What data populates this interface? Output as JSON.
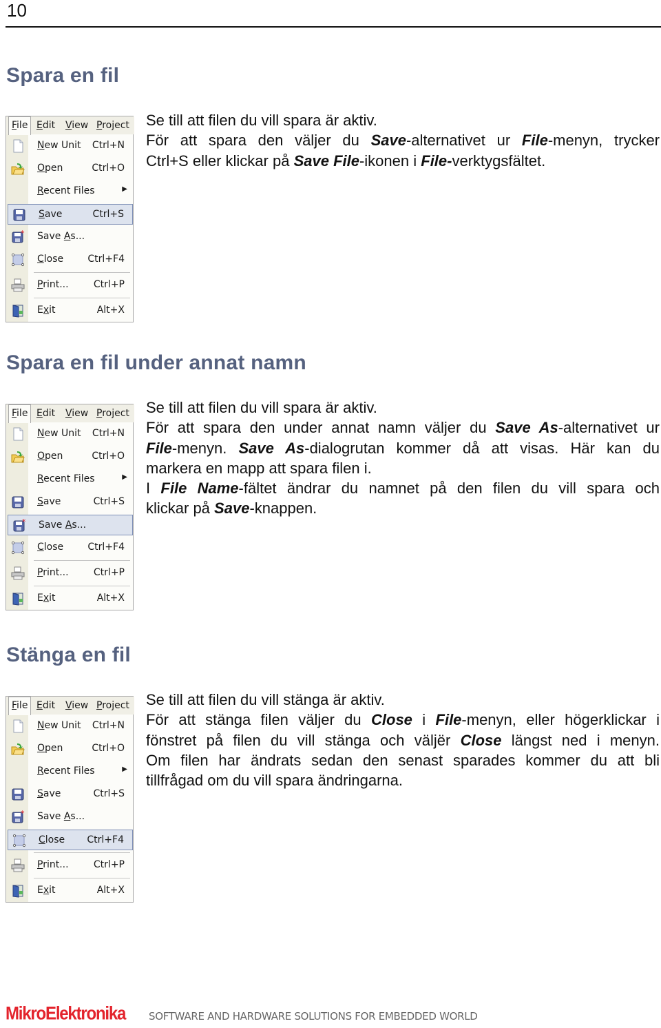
{
  "page_number": "10",
  "sections": [
    {
      "heading": "Spara en fil",
      "highlighted_item": "save",
      "lines": [
        [
          {
            "t": "Se till att filen du vill spara är aktiv."
          }
        ],
        [
          {
            "t": "För att spara den väljer du "
          },
          {
            "t": "Save",
            "b": true
          },
          {
            "t": "-alternativet ur "
          },
          {
            "t": "File",
            "b": true
          },
          {
            "t": "-menyn, trycker"
          }
        ],
        [
          {
            "t": "Ctrl+S eller klickar på "
          },
          {
            "t": "Save File",
            "b": true
          },
          {
            "t": "-ikonen i "
          },
          {
            "t": "File-",
            "b": true
          },
          {
            "t": "verktygsfältet."
          }
        ]
      ]
    },
    {
      "heading": "Spara en fil under annat namn",
      "highlighted_item": "save_as",
      "lines": [
        [
          {
            "t": "Se till att filen du vill spara är aktiv."
          }
        ],
        [
          {
            "t": "För att spara den under annat namn väljer du "
          },
          {
            "t": "Save As",
            "b": true
          },
          {
            "t": "-alternativet ur"
          }
        ],
        [
          {
            "t": "File",
            "b": true
          },
          {
            "t": "-menyn. "
          },
          {
            "t": "Save As",
            "b": true
          },
          {
            "t": "-dialogrutan kommer då att visas. Här kan du"
          }
        ],
        [
          {
            "t": "markera en mapp att spara filen i."
          }
        ],
        [
          {
            "t": "I "
          },
          {
            "t": "File Name",
            "b": true
          },
          {
            "t": "-fältet ändrar du namnet på den filen du vill spara och"
          }
        ],
        [
          {
            "t": "klickar på "
          },
          {
            "t": "Save",
            "b": true
          },
          {
            "t": "-knappen."
          }
        ]
      ]
    },
    {
      "heading": "Stänga en fil",
      "highlighted_item": "close",
      "lines": [
        [
          {
            "t": "Se till att filen du vill stänga är aktiv."
          }
        ],
        [
          {
            "t": "För att stänga filen väljer du "
          },
          {
            "t": "Close",
            "b": true
          },
          {
            "t": " i "
          },
          {
            "t": "File",
            "b": true
          },
          {
            "t": "-menyn, eller högerklickar i"
          }
        ],
        [
          {
            "t": "fönstret på filen du vill stänga och väljër "
          },
          {
            "t": "Close",
            "b": true
          },
          {
            "t": " längst ned i menyn."
          }
        ],
        [
          {
            "t": "Om filen har ändrats sedan den senast sparades kommer du att bli"
          }
        ],
        [
          {
            "t": "tillfrågad om du vill spara ändringarna."
          }
        ]
      ]
    }
  ],
  "menu": {
    "menubar": [
      {
        "label": "File",
        "ul": 0
      },
      {
        "label": "Edit",
        "ul": 0
      },
      {
        "label": "View",
        "ul": 0
      },
      {
        "label": "Project",
        "ul": 0
      }
    ],
    "items": [
      {
        "id": "new_unit",
        "label": "New Unit",
        "ul": 0,
        "shortcut": "Ctrl+N",
        "icon": "new-file-icon"
      },
      {
        "id": "open",
        "label": "Open",
        "ul": 0,
        "shortcut": "Ctrl+O",
        "icon": "open-folder-icon"
      },
      {
        "id": "recent",
        "label": "Recent Files",
        "ul": 0,
        "shortcut": "",
        "submenu": true,
        "icon": ""
      },
      {
        "id": "save",
        "label": "Save",
        "ul": 0,
        "shortcut": "Ctrl+S",
        "icon": "save-icon"
      },
      {
        "id": "save_as",
        "label": "Save As...",
        "ul": 5,
        "shortcut": "",
        "icon": "save-as-icon"
      },
      {
        "id": "close",
        "label": "Close",
        "ul": 0,
        "shortcut": "Ctrl+F4",
        "icon": "close-file-icon"
      },
      {
        "id": "print",
        "label": "Print...",
        "ul": 0,
        "shortcut": "Ctrl+P",
        "icon": "printer-icon"
      },
      {
        "id": "exit",
        "label": "Exit",
        "ul": 1,
        "shortcut": "Alt+X",
        "icon": "exit-door-icon"
      }
    ],
    "submenu_arrow": "▶"
  },
  "footer": {
    "brand": "MikroElektronika",
    "tagline": "SOFTWARE AND HARDWARE SOLUTIONS FOR EMBEDDED WORLD",
    "brand_color": "#e3232c"
  },
  "colors": {
    "heading": "#55617f",
    "menu_highlight": "#dde3ee",
    "menu_highlight_border": "#7d8eb5"
  }
}
